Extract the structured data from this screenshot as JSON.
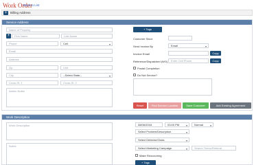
{
  "header": {
    "title": "Work Order",
    "back_link": "Back to List"
  },
  "billing": {
    "label": "Billing Address"
  },
  "service": {
    "section_title": "Service Address",
    "name_placeholder": "Name of Property",
    "first_name_placeholder": "First Name",
    "last_name_placeholder": "Last Name",
    "phone_placeholder": "Phone",
    "phone_type": "Cell",
    "email_placeholder": "Email",
    "address_placeholder": "Address",
    "zip_placeholder": "Zip",
    "unit_placeholder": "Unit",
    "city_placeholder": "City",
    "state_select": "--Select State--",
    "cross_st1_placeholder": "Cross St. 1",
    "cross_st2_placeholder": "Cross St. 2",
    "notes_placeholder": "Admin Notes"
  },
  "right": {
    "tags_button": "Tags",
    "customer_since_label": "Customer Since",
    "send_invoice_label": "Send Invoice By",
    "send_invoice_value": "Email",
    "invoice_email_label": "Invoice Email",
    "copy_button": "Copy",
    "ref_label": "Reference/Dispatched (WO)",
    "ref_placeholder": "Enter Cell Phone",
    "copy_button2": "Copy",
    "postal_label": "Postal Completion",
    "donot_label": "Do Not Service?",
    "reset_button": "Reset",
    "find_button": "Find Service Location",
    "save_button": "Save Customer",
    "add_agreement_button": "Add Existing Agreement"
  },
  "work": {
    "section_title": "Work Description",
    "job_placeholder": "Work Description",
    "notes_placeholder": "Notes",
    "date_value": "08/06/2018",
    "time_value": "03:00 PM",
    "priority_value": "Normal",
    "problem_select": "Select Problem/Description",
    "dept_select": "Select Detector/Class",
    "campaign_select": "Select Marketing Campaign",
    "search_placeholder": "Search Terms/Referral",
    "make_recurring_label": "Make Reoccurring",
    "tags_button": "Tags"
  },
  "colors": {
    "accent": "#1f4e79",
    "section_header": "#5b7fa8",
    "reset": "#d9534f",
    "find": "#e8a0a0",
    "save": "#5cb85c",
    "add_agreement": "#6c757d",
    "title": "#c0392b"
  }
}
